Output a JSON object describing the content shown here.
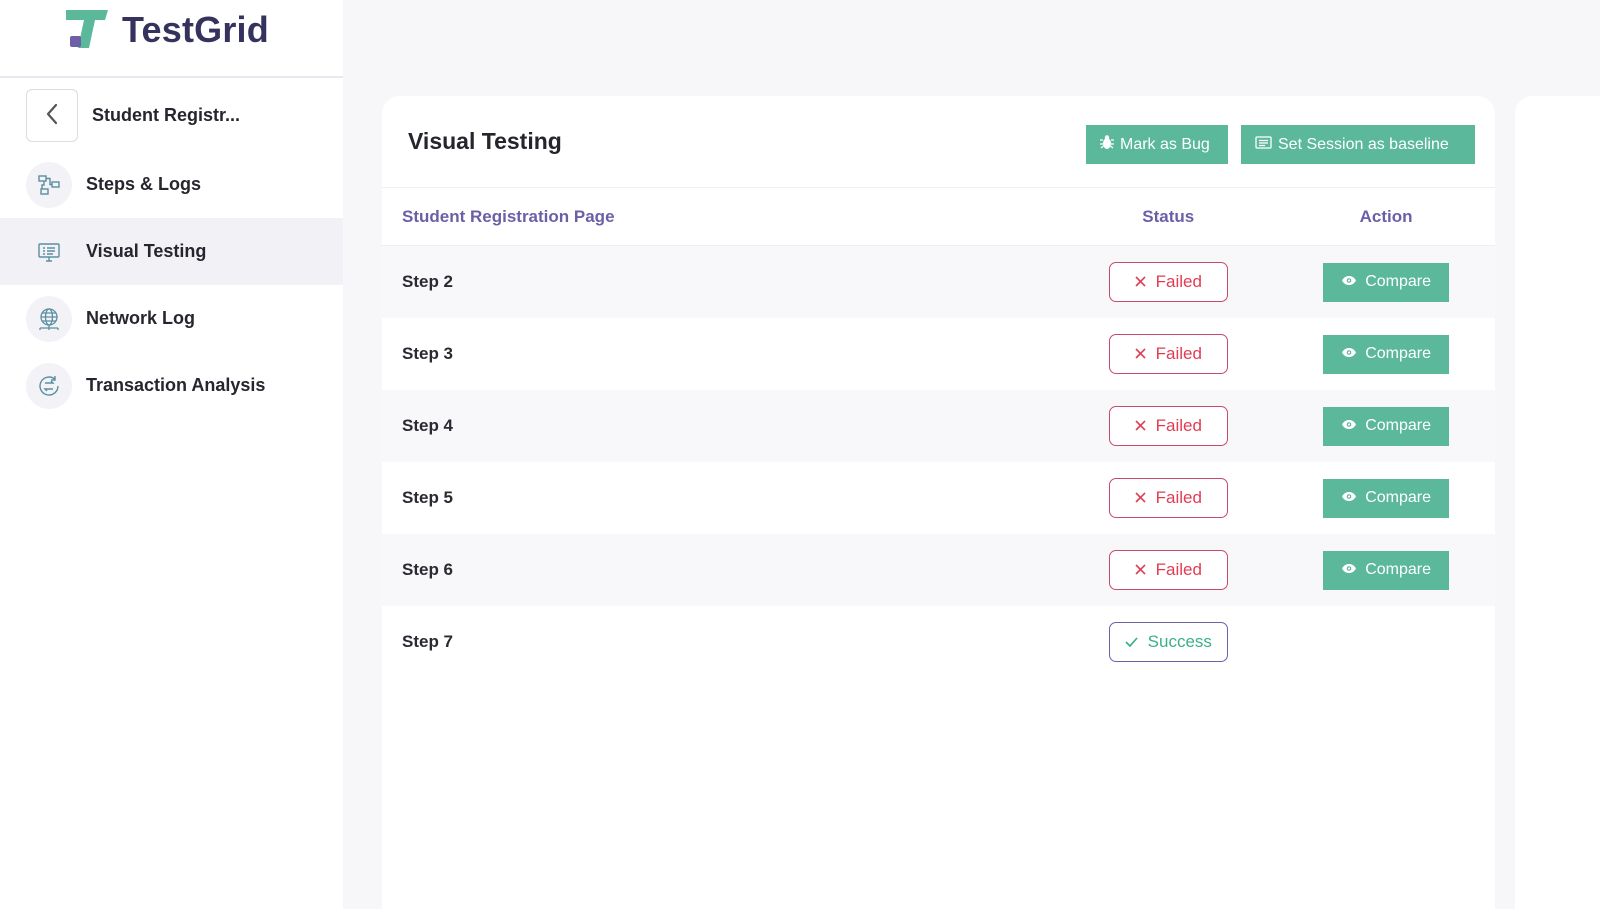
{
  "brand": {
    "name": "TestGrid"
  },
  "sidebar": {
    "back_title": "Student Registr...",
    "items": [
      {
        "label": "Steps & Logs",
        "icon": "steps-logs-icon"
      },
      {
        "label": "Visual Testing",
        "icon": "monitor-icon",
        "active": true
      },
      {
        "label": "Network Log",
        "icon": "globe-network-icon"
      },
      {
        "label": "Transaction Analysis",
        "icon": "transaction-icon"
      }
    ]
  },
  "main": {
    "title": "Visual Testing",
    "mark_bug_label": "Mark as Bug",
    "baseline_label": "Set Session as baseline",
    "table": {
      "headers": {
        "name": "Student Registration Page",
        "status": "Status",
        "action": "Action"
      },
      "rows": [
        {
          "step": "Step 2",
          "status": "Failed",
          "action": "Compare"
        },
        {
          "step": "Step 3",
          "status": "Failed",
          "action": "Compare"
        },
        {
          "step": "Step 4",
          "status": "Failed",
          "action": "Compare"
        },
        {
          "step": "Step 5",
          "status": "Failed",
          "action": "Compare"
        },
        {
          "step": "Step 6",
          "status": "Failed",
          "action": "Compare"
        },
        {
          "step": "Step 7",
          "status": "Success",
          "action": ""
        }
      ]
    }
  },
  "colors": {
    "accent_green": "#5bb89b",
    "brand_purple": "#35325e",
    "header_purple": "#6c5fa8",
    "failed_red": "#e03d52",
    "success_green": "#3cb089"
  }
}
